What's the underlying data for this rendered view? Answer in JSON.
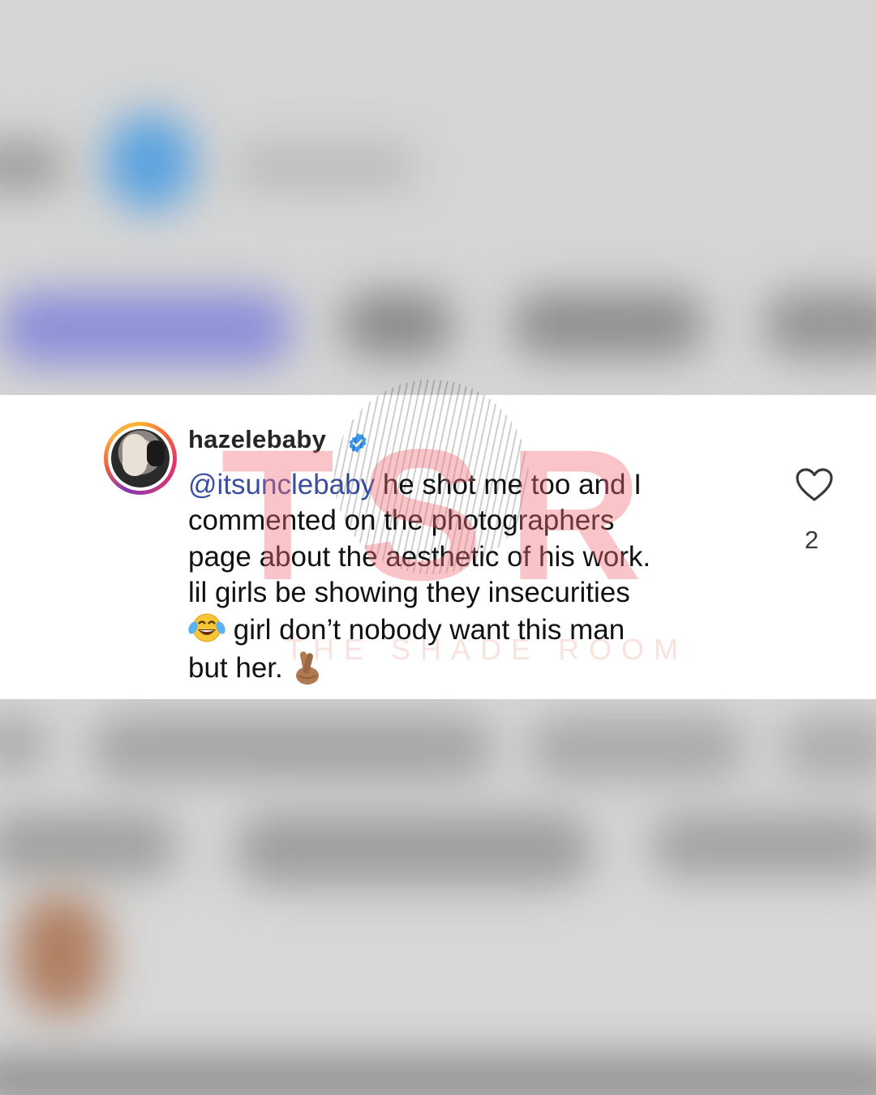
{
  "comment": {
    "username": "hazelebaby",
    "verified": true,
    "mention": "@itsunclebaby",
    "lines": [
      " he shot me too and I",
      "commented on the photographers",
      "page about the aesthetic of his work.",
      "lil girls be showing they insecurities"
    ],
    "line5_text": " girl don’t nobody want this man",
    "line6_text": "but her. ",
    "like_count": "2"
  },
  "icons": {
    "verified": "verified-badge-icon",
    "like": "heart-icon",
    "laugh_emoji": "tears-of-joy-emoji",
    "crossed_fingers_emoji": "crossed-fingers-emoji"
  },
  "watermark": {
    "logo_letters": "TSR",
    "logo_subtitle": "THE SHADE ROOM"
  },
  "colors": {
    "mention": "#3a4fa0",
    "verified": "#3897f0",
    "watermark": "#f06e78"
  }
}
